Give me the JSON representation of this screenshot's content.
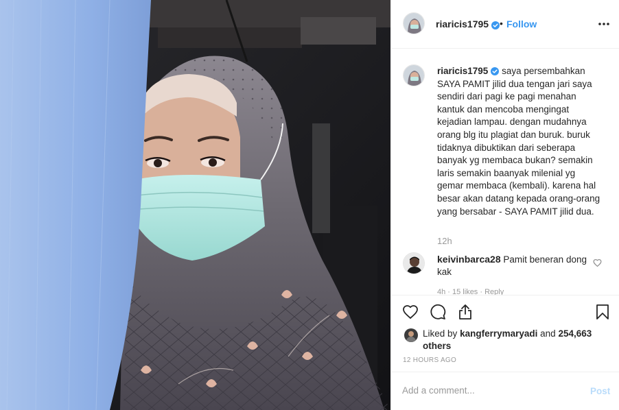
{
  "post": {
    "username": "riaricis1795",
    "follow_label": "Follow",
    "separator": "•"
  },
  "caption": {
    "username": "riaricis1795",
    "text": "saya persembahkan SAYA PAMIT jilid dua tengan jari saya sendiri dari pagi ke pagi menahan kantuk dan mencoba mengingat kejadian lampau. dengan mudahnya orang blg itu plagiat dan buruk. buruk tidaknya dibuktikan dari seberapa banyak yg membaca bukan? semakin laris semakin baanyak milenial yg gemar membaca (kembali). karena hal besar akan datang kepada orang-orang yang bersabar - SAYA PAMIT jilid dua.",
    "time": "12h"
  },
  "comments": [
    {
      "username": "keivinbarca28",
      "text": "Pamit beneran dong kak",
      "meta": "4h  ·  15 likes  ·  Reply"
    }
  ],
  "likes": {
    "prefix": "Liked by",
    "user": "kangferrymaryadi",
    "and": "and",
    "others": "254,663 others"
  },
  "timestamp": "12 HOURS AGO",
  "add_comment": {
    "placeholder": "Add a comment...",
    "post_label": "Post"
  },
  "colors": {
    "link_blue": "#3897f0",
    "post_disabled": "#b9dcfb",
    "muted": "#999999",
    "divider": "#efefef"
  },
  "icons": [
    "verified-badge-icon",
    "more-options-icon",
    "heart-icon",
    "comment-icon",
    "share-icon",
    "bookmark-icon"
  ]
}
